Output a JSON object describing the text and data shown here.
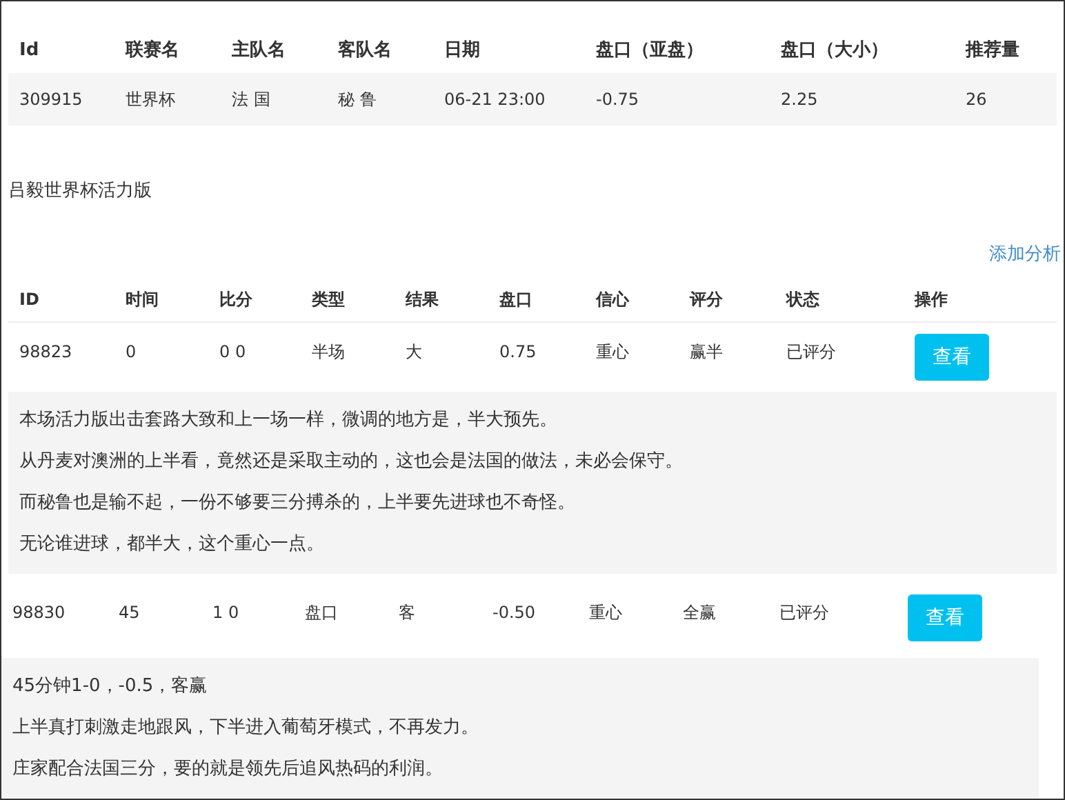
{
  "match_table": {
    "columns": [
      "Id",
      "联赛名",
      "主队名",
      "客队名",
      "日期",
      "盘口（亚盘）",
      "盘口（大小）",
      "推荐量"
    ],
    "rows": [
      {
        "cells": [
          "309915",
          "世界杯",
          "法 国",
          "秘 鲁",
          "06-21 23:00",
          "-0.75",
          "2.25",
          "26"
        ]
      }
    ]
  },
  "section_title": "吕毅世界杯活力版",
  "add_analysis_link": "添加分析",
  "analysis_table": {
    "columns": [
      "ID",
      "时间",
      "比分",
      "类型",
      "结果",
      "盘口",
      "信心",
      "评分",
      "状态",
      "操作"
    ],
    "entries": [
      {
        "cells": [
          "98823",
          "0",
          "0 0",
          "半场",
          "大",
          "0.75",
          "重心",
          "赢半",
          "已评分"
        ],
        "button": "查看",
        "comments": [
          "本场活力版出击套路大致和上一场一样，微调的地方是，半大预先。",
          "从丹麦对澳洲的上半看，竟然还是采取主动的，这也会是法国的做法，未必会保守。",
          "而秘鲁也是输不起，一份不够要三分搏杀的，上半要先进球也不奇怪。",
          "无论谁进球，都半大，这个重心一点。"
        ]
      },
      {
        "cells": [
          "98830",
          "45",
          "1 0",
          "盘口",
          "客",
          "-0.50",
          "重心",
          "全赢",
          "已评分"
        ],
        "button": "查看",
        "comments": [
          "45分钟1-0，-0.5，客赢",
          "上半真打刺激走地跟风，下半进入葡萄牙模式，不再发力。",
          "庄家配合法国三分，要的就是领先后追风热码的利润。"
        ]
      }
    ]
  }
}
